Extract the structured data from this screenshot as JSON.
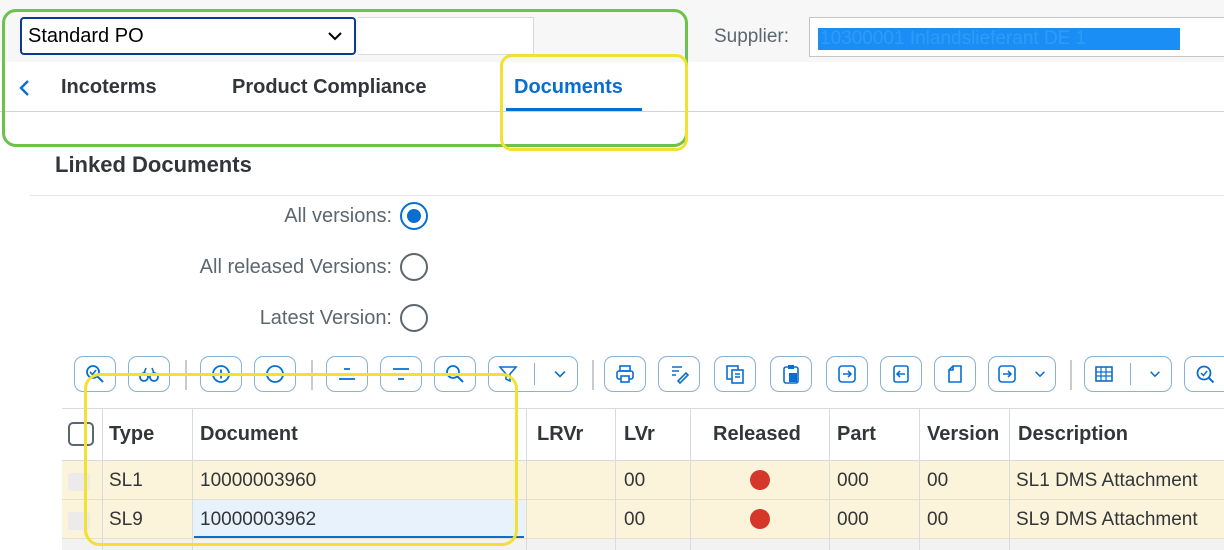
{
  "header": {
    "po_type": "Standard PO",
    "supplier_label": "Supplier:",
    "supplier_value": "10300001 Inlandslieferant DE 1"
  },
  "tabs": [
    {
      "label": "Incoterms",
      "active": false
    },
    {
      "label": "Product Compliance",
      "active": false
    },
    {
      "label": "Documents",
      "active": true
    }
  ],
  "section": {
    "title": "Linked Documents"
  },
  "version_filter": {
    "all_versions": {
      "label": "All versions:",
      "selected": true
    },
    "all_released": {
      "label": "All released Versions:",
      "selected": false
    },
    "latest": {
      "label": "Latest Version:",
      "selected": false
    }
  },
  "toolbar": {
    "icons": [
      "check-doc-icon",
      "display-icon",
      "create-icon",
      "delete-icon",
      "sort-ascending-icon",
      "sort-descending-icon",
      "find-icon",
      "filter-icon",
      "print-icon",
      "change-icon",
      "copy-icon",
      "paste-icon",
      "export-icon",
      "import-icon",
      "new-doc-icon",
      "views-icon",
      "layout-grid-icon",
      "zoom-icon"
    ]
  },
  "table": {
    "columns": [
      "Type",
      "Document",
      "LRVr",
      "LVr",
      "Released",
      "Part",
      "Version",
      "Description"
    ],
    "rows": [
      {
        "type": "SL1",
        "document": "10000003960",
        "lrvr": "",
        "lvr": "00",
        "released_status": "red",
        "part": "000",
        "version": "00",
        "description": "SL1 DMS Attachment"
      },
      {
        "type": "SL9",
        "document": "10000003962",
        "lrvr": "",
        "lvr": "00",
        "released_status": "red",
        "part": "000",
        "version": "00",
        "description": "SL9 DMS Attachment"
      }
    ]
  },
  "colors": {
    "accent": "#0a6ed1",
    "status_red": "#d5372b",
    "highlight_green": "#6cc24a",
    "highlight_yellow": "#f2e033",
    "row_bg": "#fbf3da"
  }
}
